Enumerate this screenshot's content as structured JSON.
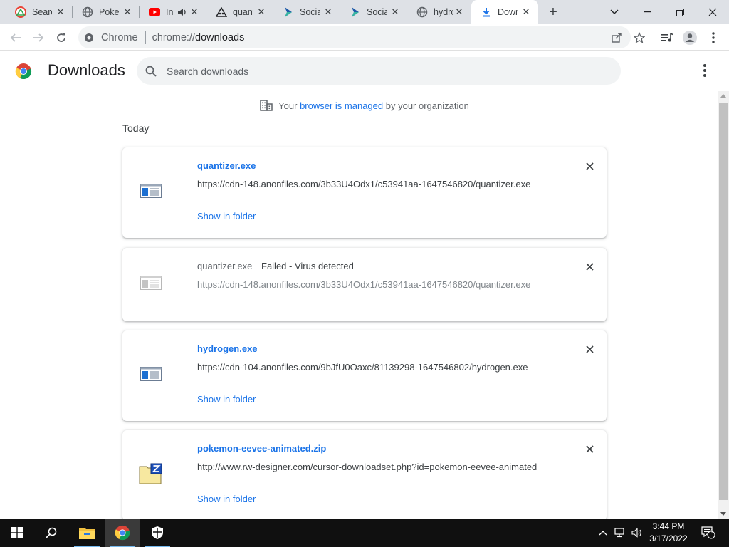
{
  "browser": {
    "tabs": [
      {
        "title": "Search",
        "favicon": "google-icon"
      },
      {
        "title": "Pokemon",
        "favicon": "globe-icon"
      },
      {
        "title": "In",
        "favicon": "youtube-icon",
        "audio": true
      },
      {
        "title": "quantizer",
        "favicon": "anonfiles-icon"
      },
      {
        "title": "Social",
        "favicon": "social-icon"
      },
      {
        "title": "Social",
        "favicon": "social-icon"
      },
      {
        "title": "hydrogen",
        "favicon": "globe-icon"
      },
      {
        "title": "Downloads",
        "favicon": "download-icon",
        "active": true
      }
    ],
    "omnibox": {
      "site_chip": "Chrome",
      "url_scheme": "chrome://",
      "url_host": "downloads"
    }
  },
  "downloads": {
    "title": "Downloads",
    "search_placeholder": "Search downloads",
    "managed_notice": {
      "prefix": "Your",
      "link": "browser is managed",
      "suffix": "by your organization"
    },
    "date_header": "Today",
    "items": [
      {
        "file_name": "quantizer.exe",
        "url": "https://cdn-148.anonfiles.com/3b33U4Odx1/c53941aa-1647546820/quantizer.exe",
        "action": "Show in folder",
        "status": "",
        "file_icon": "exe-file-icon"
      },
      {
        "file_name": "quantizer.exe",
        "url": "https://cdn-148.anonfiles.com/3b33U4Odx1/c53941aa-1647546820/quantizer.exe",
        "action": "",
        "status": "Failed - Virus detected",
        "file_icon": "exe-file-icon-disabled"
      },
      {
        "file_name": "hydrogen.exe",
        "url": "https://cdn-104.anonfiles.com/9bJfU0Oaxc/81139298-1647546802/hydrogen.exe",
        "action": "Show in folder",
        "status": "",
        "file_icon": "exe-file-icon"
      },
      {
        "file_name": "pokemon-eevee-animated.zip",
        "url": "http://www.rw-designer.com/cursor-downloadset.php?id=pokemon-eevee-animated",
        "action": "Show in folder",
        "status": "",
        "file_icon": "zip-file-icon"
      }
    ]
  },
  "taskbar": {
    "time": "3:44 PM",
    "date": "3/17/2022",
    "notification_count": "1"
  },
  "colors": {
    "accent": "#1a73e8",
    "tabstrip": "#dee1e6",
    "taskbar": "#101010"
  }
}
